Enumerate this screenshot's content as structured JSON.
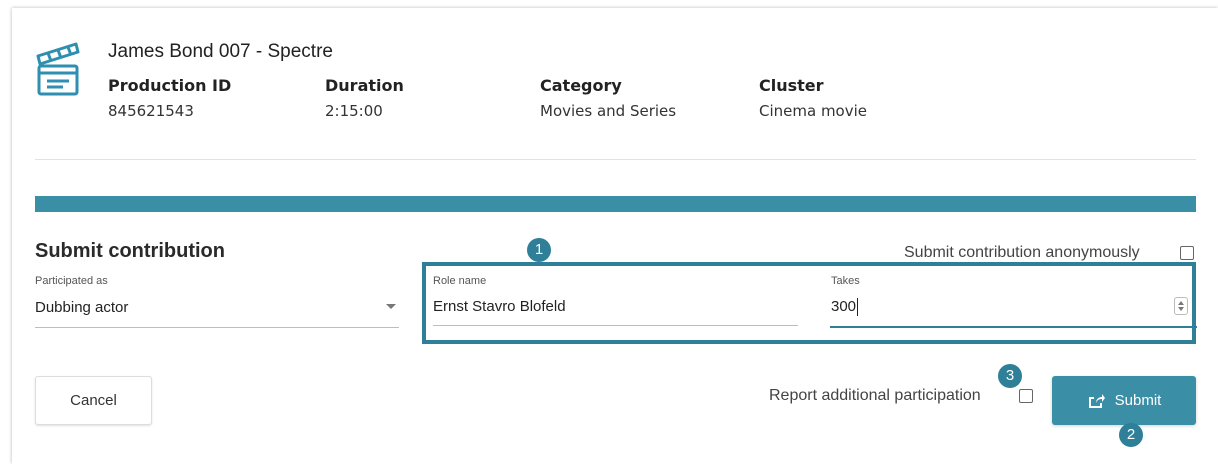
{
  "production": {
    "title": "James Bond 007 - Spectre",
    "production_id_label": "Production ID",
    "production_id": "845621543",
    "duration_label": "Duration",
    "duration": "2:15:00",
    "category_label": "Category",
    "category": "Movies and Series",
    "cluster_label": "Cluster",
    "cluster": "Cinema movie"
  },
  "progress": {
    "percent": 100,
    "color": "#3a8ea6"
  },
  "form": {
    "section_title": "Submit contribution",
    "anonymous_label": "Submit contribution anonymously",
    "anonymous_checked": false,
    "participated_as_label": "Participated as",
    "participated_as_value": "Dubbing actor",
    "role_name_label": "Role name",
    "role_name_value": "Ernst Stavro Blofeld",
    "takes_label": "Takes",
    "takes_value": "300",
    "report_additional_label": "Report additional participation",
    "report_additional_checked": false,
    "cancel_label": "Cancel",
    "submit_label": "Submit",
    "submit_icon": "share-icon"
  },
  "callouts": {
    "badge_1": "1",
    "badge_2": "2",
    "badge_3": "3"
  },
  "colors": {
    "accent": "#3a8ea6",
    "highlight": "#2e7f97"
  }
}
